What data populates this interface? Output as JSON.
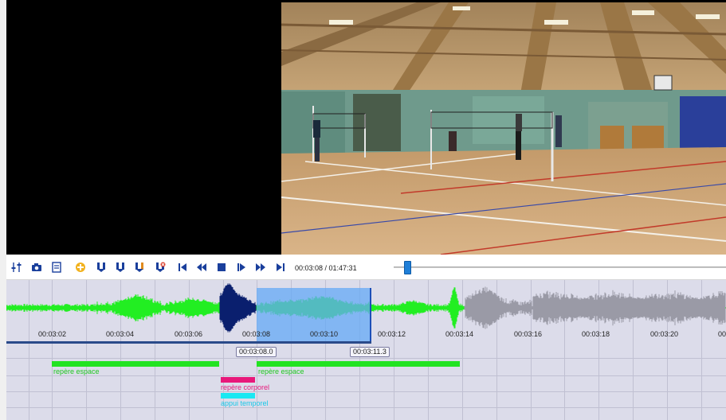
{
  "player": {
    "time_display": "00:03:08 / 01:47:31",
    "progress": 0.03
  },
  "toolbar": {
    "buttons": [
      {
        "name": "settings-sliders-button",
        "icon": "sliders-icon"
      },
      {
        "name": "snapshot-button",
        "icon": "camera-icon"
      },
      {
        "name": "export-button",
        "icon": "document-icon"
      },
      {
        "name": "add-marker-button",
        "icon": "add-marker-icon"
      },
      {
        "name": "marker-type-1-button",
        "icon": "marker-blue-icon"
      },
      {
        "name": "marker-type-2-button",
        "icon": "marker-blue-icon"
      },
      {
        "name": "marker-type-3-button",
        "icon": "marker-orange-icon"
      },
      {
        "name": "delete-marker-button",
        "icon": "marker-delete-icon"
      },
      {
        "name": "go-to-start-button",
        "icon": "skip-start-icon"
      },
      {
        "name": "rewind-button",
        "icon": "rewind-icon"
      },
      {
        "name": "stop-button",
        "icon": "stop-icon"
      },
      {
        "name": "play-button",
        "icon": "play-icon"
      },
      {
        "name": "fast-forward-button",
        "icon": "fast-forward-icon"
      },
      {
        "name": "go-to-end-button",
        "icon": "skip-end-icon"
      }
    ],
    "colors": {
      "accent": "#1a3f9c",
      "orange": "#e08a1e",
      "red": "#d93c2a",
      "slider": "#1f7fd8"
    }
  },
  "timeline": {
    "ticks": [
      "00:03:02",
      "00:03:04",
      "00:03:06",
      "00:03:08",
      "00:03:10",
      "00:03:12",
      "00:03:14",
      "00:03:16",
      "00:03:18",
      "00:03:20",
      "00:"
    ],
    "selection_start": "00:03:08.0",
    "selection_end": "00:03:11.3",
    "colors": {
      "background": "#dcdcea",
      "waveform_green": "#22ee22",
      "waveform_dark": "#0a1f6e",
      "waveform_gray": "#9a9aa6",
      "selection": "#6aaef5"
    },
    "events": [
      {
        "label": "repère espace",
        "color": "#22e322",
        "label_color": "#22c822"
      },
      {
        "label": "repère espace",
        "color": "#22e322",
        "label_color": "#22c822"
      },
      {
        "label": "repère corporel",
        "color": "#e8187a",
        "label_color": "#e8187a"
      },
      {
        "label": "appui temporel",
        "color": "#19e8f2",
        "label_color": "#19c8e8"
      }
    ]
  }
}
